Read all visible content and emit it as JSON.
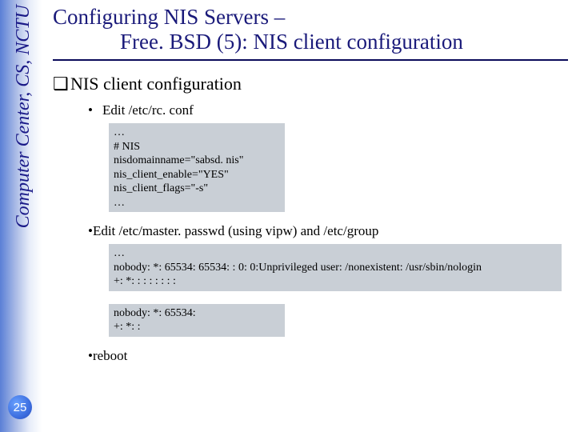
{
  "sidebar": {
    "text": "Computer Center, CS, NCTU"
  },
  "page_number": "25",
  "title": {
    "line1": "Configuring NIS Servers –",
    "line2": "Free. BSD (5): NIS client configuration"
  },
  "section_label": "NIS client configuration",
  "bullets": {
    "item1": "Edit /etc/rc. conf",
    "item2": "Edit /etc/master. passwd (using vipw) and /etc/group",
    "item3": "reboot"
  },
  "code": {
    "rcconf": "…\n# NIS\nnisdomainname=\"sabsd. nis\"\nnis_client_enable=\"YES\"\nnis_client_flags=\"-s\"\n…",
    "passwd": "…\nnobody: *: 65534: 65534: : 0: 0:Unprivileged user: /nonexistent: /usr/sbin/nologin\n+: *: : : : : : : :",
    "group": "nobody: *: 65534:\n+: *: :"
  }
}
